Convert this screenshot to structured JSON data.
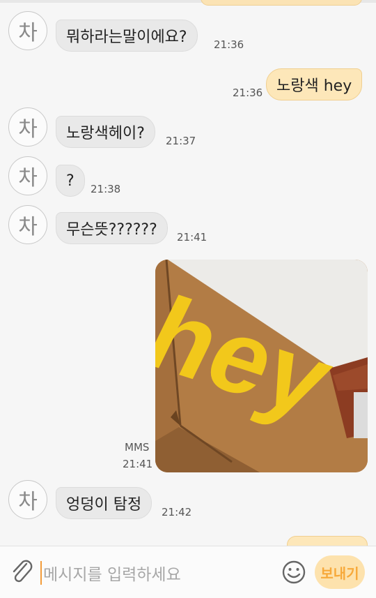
{
  "contact_initial": "차",
  "messages": [
    {
      "text": "뭐하라는말이에요?",
      "time": "21:36",
      "dir": "in"
    },
    {
      "text": "노랑색 hey",
      "time": "21:36",
      "dir": "out"
    },
    {
      "text": "노랑색헤이?",
      "time": "21:37",
      "dir": "in"
    },
    {
      "text": "?",
      "time": "21:38",
      "dir": "in"
    },
    {
      "text": "무슨뜻??????",
      "time": "21:41",
      "dir": "in"
    },
    {
      "text": "엉덩이 탐정",
      "time": "21:42",
      "dir": "in"
    }
  ],
  "mms": {
    "label": "MMS",
    "time": "21:41",
    "image_text": "hey"
  },
  "composer": {
    "placeholder": "메시지를 입력하세요",
    "send_label": "보내기"
  },
  "colors": {
    "outgoing": "#fde7b9",
    "incoming": "#e9e9e9",
    "accent": "#f7a93a"
  }
}
